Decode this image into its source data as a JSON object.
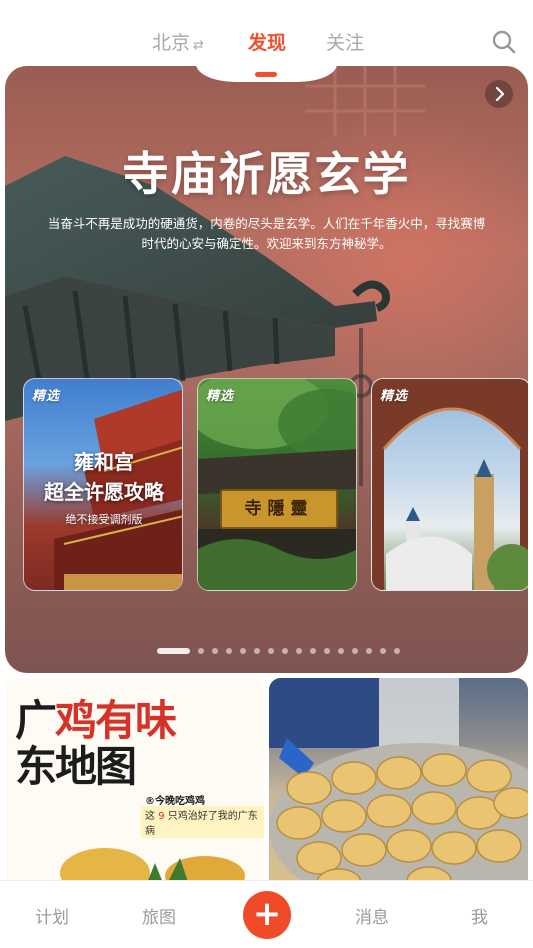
{
  "topnav": {
    "city": "北京",
    "city_swap_icon": "⇄",
    "tab_discover": "发现",
    "tab_follow": "关注",
    "search_icon": "search-icon"
  },
  "hero": {
    "title": "寺庙祈愿玄学",
    "description": "当奋斗不再是成功的硬通货，内卷的尽头是玄学。人们在千年香火中，寻找赛博时代的心安与确定性。欢迎来到东方神秘学。",
    "next_icon": "chevron-right-icon",
    "cards": [
      {
        "badge": "精选",
        "title_line1": "雍和宫",
        "title_line2": "超全许愿攻略",
        "subtitle": "绝不接受调剂版"
      },
      {
        "badge": "精选",
        "plaque": "寺隱靈"
      },
      {
        "badge": "精选"
      }
    ],
    "carousel": {
      "pages": 16,
      "active": 1
    }
  },
  "feed": {
    "left": {
      "title_a": "广",
      "title_b": "鸡有",
      "title_c": "味",
      "title_d": "东",
      "title_e": "地图",
      "tag": "®今晚吃鸡鸡",
      "sub_prefix": "这",
      "sub_num": "9",
      "sub_suffix": "只鸡治好了我的广东病"
    }
  },
  "tabbar": {
    "plan": "计划",
    "map": "旅图",
    "add": "+",
    "messages": "消息",
    "me": "我"
  },
  "colors": {
    "accent": "#f0502e",
    "add_button": "#ef4b29"
  }
}
